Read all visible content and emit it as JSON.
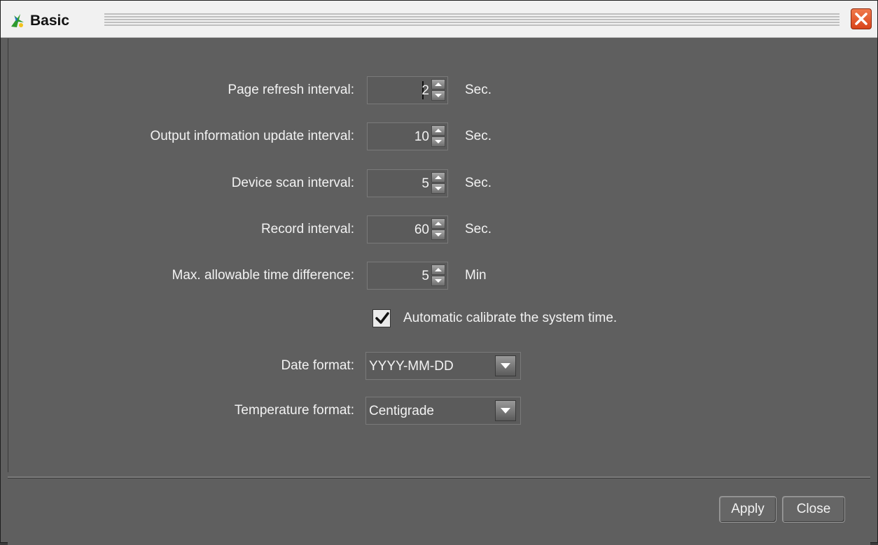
{
  "window": {
    "title": "Basic",
    "title_icon": "app-logo-icon",
    "close_icon": "close-icon"
  },
  "settings": {
    "page_refresh": {
      "label": "Page refresh interval:",
      "value": "2",
      "unit": "Sec."
    },
    "output_update": {
      "label": "Output information update interval:",
      "value": "10",
      "unit": "Sec."
    },
    "device_scan": {
      "label": "Device scan interval:",
      "value": "5",
      "unit": "Sec."
    },
    "record": {
      "label": "Record interval:",
      "value": "60",
      "unit": "Sec."
    },
    "max_time_diff": {
      "label": "Max. allowable time difference:",
      "value": "5",
      "unit": "Min"
    }
  },
  "auto_calibrate": {
    "label": "Automatic calibrate the system time.",
    "checked": true
  },
  "date_format": {
    "label": "Date format:",
    "value": "YYYY-MM-DD"
  },
  "temperature_format": {
    "label": "Temperature format:",
    "value": "Centigrade"
  },
  "buttons": {
    "apply": "Apply",
    "close": "Close"
  },
  "colors": {
    "background": "#5f5f5f",
    "text": "#f2f2f2",
    "titlebar": "#f1f1f1",
    "close_button": "#d9441a"
  }
}
